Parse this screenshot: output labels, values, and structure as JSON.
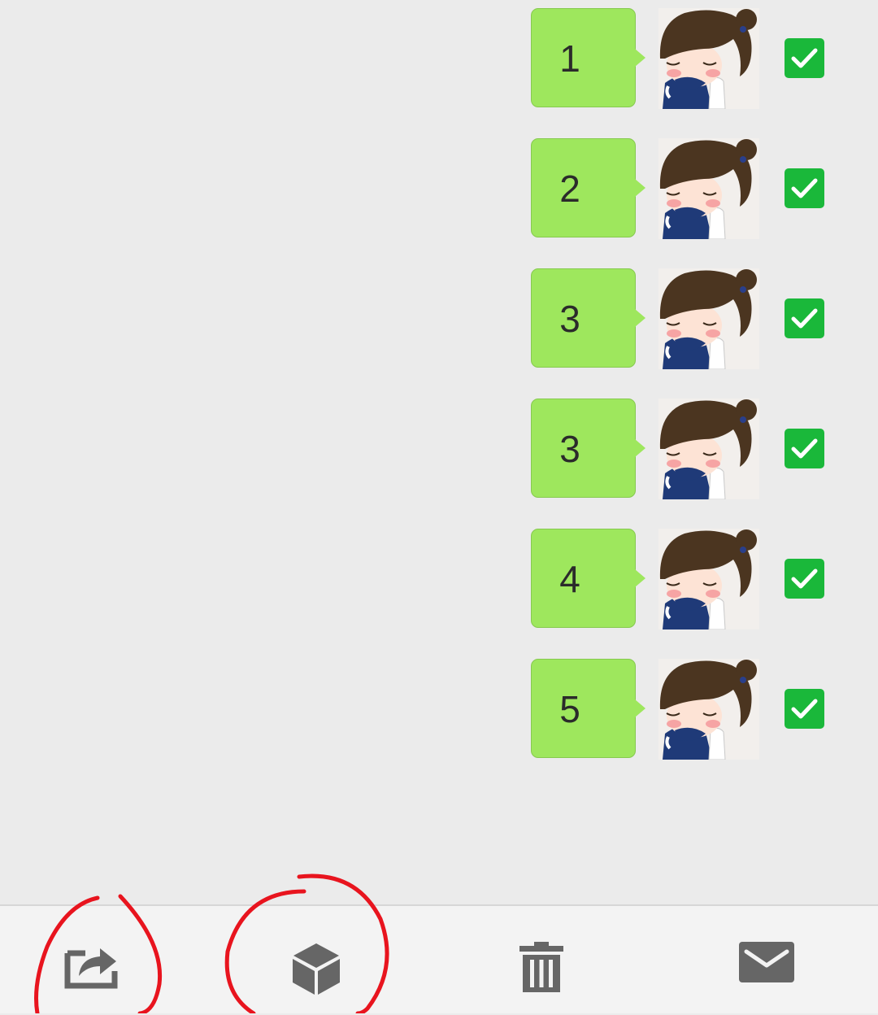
{
  "messages": [
    {
      "text": "1",
      "checked": true
    },
    {
      "text": "2",
      "checked": true
    },
    {
      "text": "3",
      "checked": true
    },
    {
      "text": "3",
      "checked": true
    },
    {
      "text": "4",
      "checked": true
    },
    {
      "text": "5",
      "checked": true
    }
  ],
  "toolbar": {
    "buttons": [
      {
        "icon": "share-icon"
      },
      {
        "icon": "cube-icon"
      },
      {
        "icon": "trash-icon"
      },
      {
        "icon": "mail-icon"
      }
    ]
  },
  "colors": {
    "background": "#ebebeb",
    "bubble": "#9ee75d",
    "checkbox": "#1ab83a",
    "toolbar": "#f3f3f3",
    "icon": "#666666",
    "annotation": "#e8141e"
  }
}
